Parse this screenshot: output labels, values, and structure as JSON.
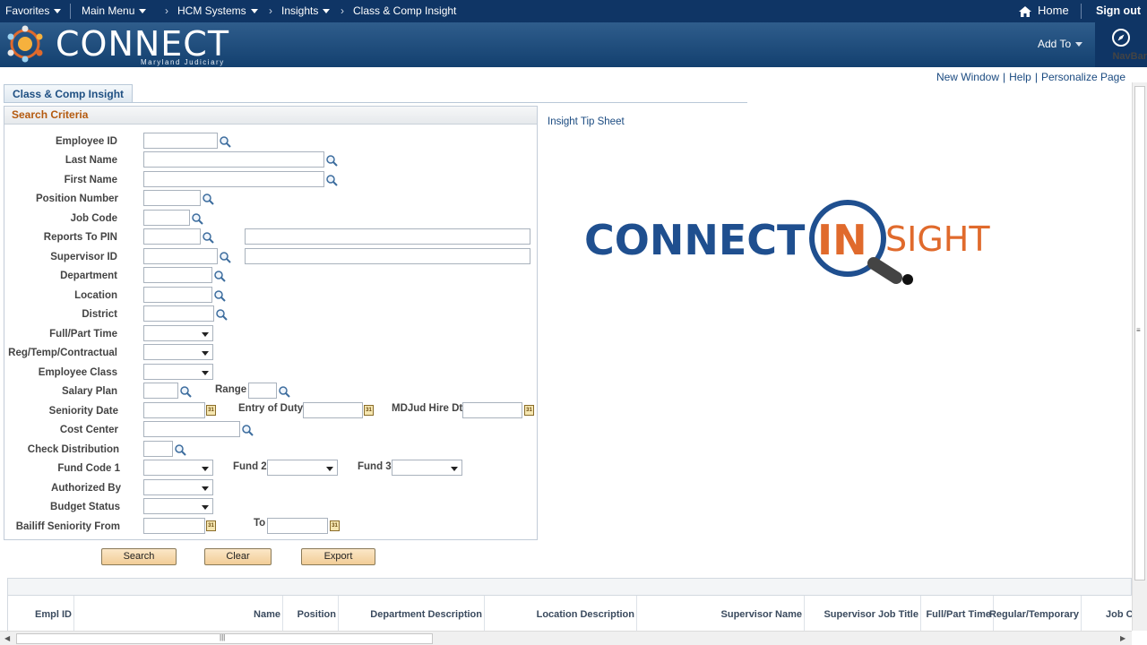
{
  "topbar": {
    "favorites": "Favorites",
    "main_menu": "Main Menu",
    "breadcrumbs": [
      "HCM Systems",
      "Insights",
      "Class & Comp Insight"
    ],
    "home": "Home",
    "sign_out": "Sign out"
  },
  "banner": {
    "brand": "CONNECT",
    "sub": "Maryland Judiciary",
    "add_to": "Add To",
    "navbar": "NavBar"
  },
  "page_links": [
    "New Window",
    "Help",
    "Personalize Page"
  ],
  "tab": {
    "label": "Class & Comp Insight"
  },
  "criteria": {
    "title": "Search Criteria",
    "employee_id": "Employee ID",
    "last_name": "Last Name",
    "first_name": "First Name",
    "position_number": "Position Number",
    "job_code": "Job Code",
    "reports_to_pin": "Reports To PIN",
    "supervisor_id": "Supervisor ID",
    "department": "Department",
    "location": "Location",
    "district": "District",
    "full_part_time": "Full/Part Time",
    "reg_temp": "Reg/Temp/Contractual",
    "employee_class": "Employee Class",
    "salary_plan": "Salary Plan",
    "range": "Range",
    "seniority_date": "Seniority Date",
    "entry_of_duty": "Entry of Duty",
    "mdjud_hire_dt": "MDJud Hire Dt",
    "cost_center": "Cost Center",
    "check_distribution": "Check Distribution",
    "fund_code_1": "Fund Code 1",
    "fund_2": "Fund 2",
    "fund_3": "Fund 3",
    "authorized_by": "Authorized By",
    "budget_status": "Budget Status",
    "bailiff_seniority_from": "Bailiff Seniority From",
    "to": "To"
  },
  "buttons": {
    "search": "Search",
    "clear": "Clear",
    "export": "Export"
  },
  "right": {
    "tip_sheet": "Insight Tip Sheet",
    "logo_connect": "CONNECT",
    "logo_in": "IN",
    "logo_sight": "SIGHT"
  },
  "grid": {
    "columns": [
      "Empl ID",
      "Name",
      "Position",
      "Department Description",
      "Location Description",
      "Supervisor Name",
      "Supervisor Job Title",
      "Full/Part Time",
      "Regular/Temporary",
      "Job C"
    ]
  },
  "colors": {
    "topbar": "#0f3565",
    "banner": "#2f5d8c",
    "section_title": "#b45a0f",
    "logo_blue": "#1f4f8f",
    "logo_orange": "#e06a2c",
    "button": "#f2cd97"
  }
}
